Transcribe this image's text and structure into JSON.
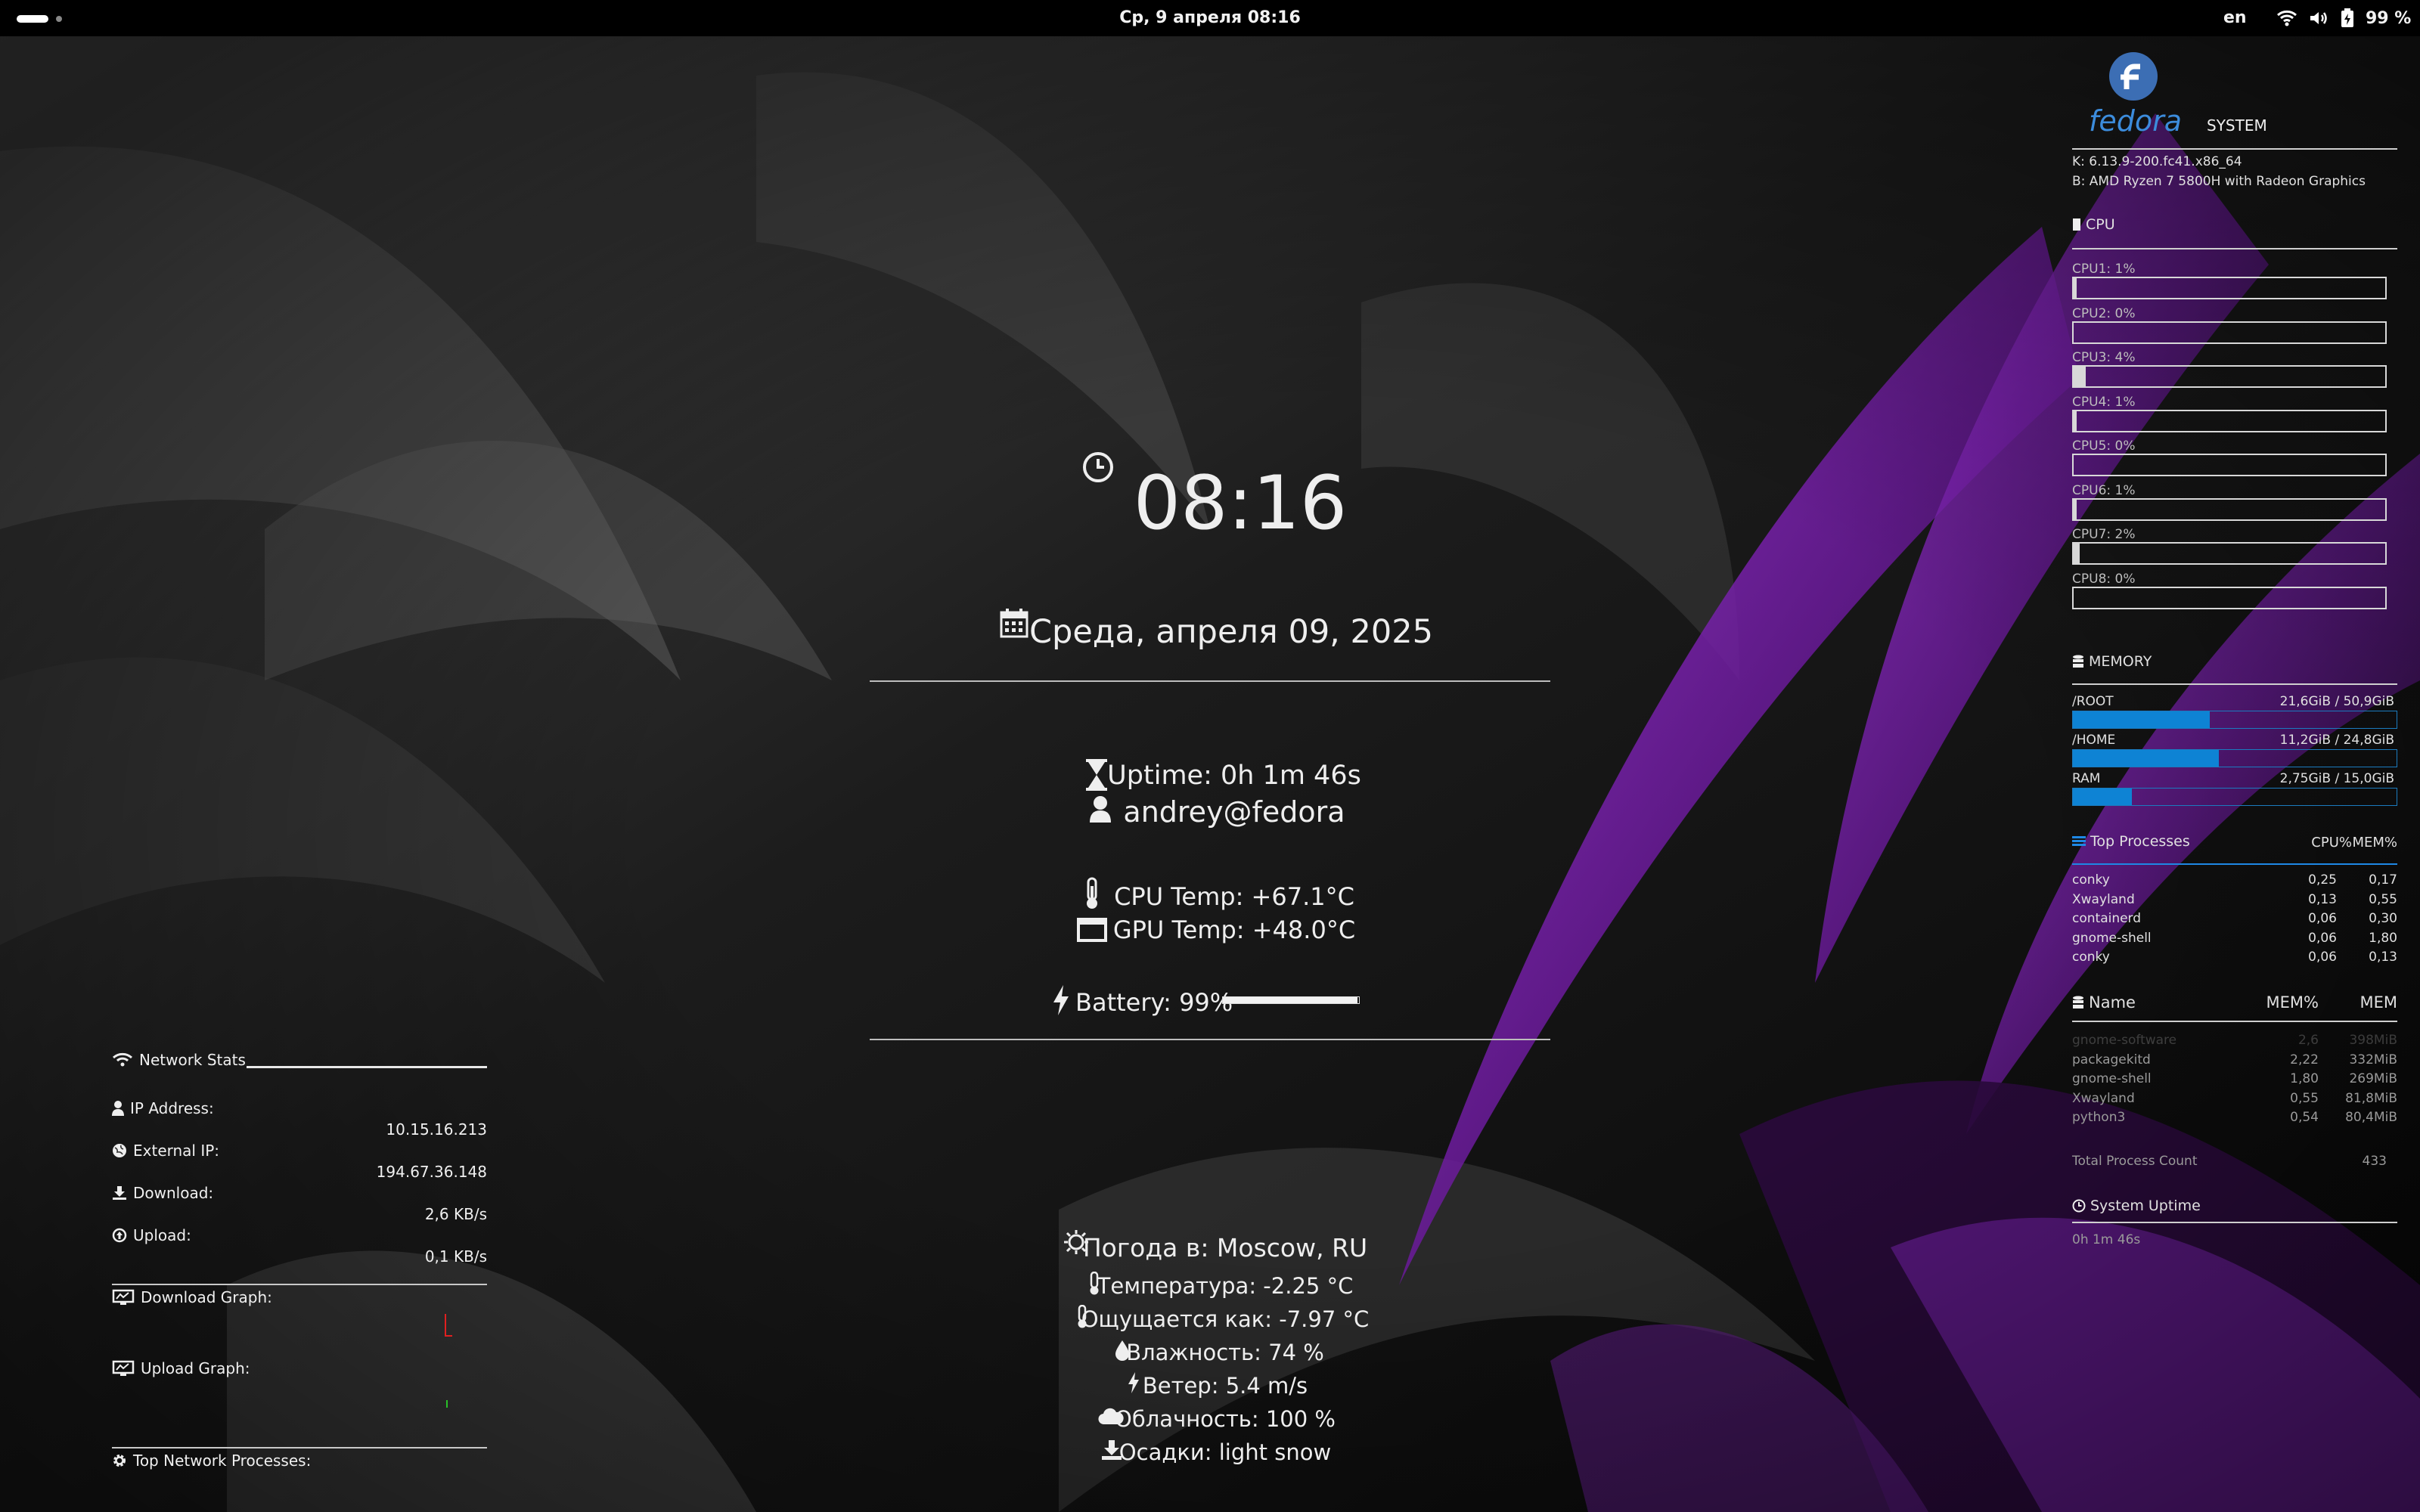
{
  "topbar": {
    "datetime": "Ср, 9 апреля  08:16",
    "lang": "en",
    "battery": "99 %",
    "icons": [
      "activities-indicator",
      "wifi-icon",
      "volume-icon",
      "battery-icon"
    ]
  },
  "center": {
    "time": "08:16",
    "date": "Среда, апреля 09, 2025",
    "uptime": "Uptime: 0h 1m 46s",
    "user": "andrey@fedora",
    "cpu_temp": "CPU Temp: +67.1°C",
    "gpu_temp": "GPU Temp: +48.0°C",
    "battery": "Battery: 99%",
    "battery_level": 0.99,
    "weather": {
      "title": "Погода в: Moscow, RU",
      "temperature": "Температура: -2.25 °C",
      "feels": "Ощущается как: -7.97 °C",
      "humidity": "Влажность: 74 %",
      "wind": "Ветер: 5.4 m/s",
      "clouds": "Облачность: 100 %",
      "precip": "Осадки: light snow"
    }
  },
  "network": {
    "title": "Network Stats",
    "ip_label": "IP Address:",
    "ip": "10.15.16.213",
    "ext_label": "External IP:",
    "ext_ip": "194.67.36.148",
    "down_label": "Download:",
    "down": "2,6 KB/s",
    "up_label": "Upload:",
    "up": "0,1 KB/s",
    "down_graph": "Download Graph:",
    "up_graph": "Upload Graph:",
    "top_proc": "Top Network Processes:"
  },
  "system": {
    "logo": "fedora",
    "section": "SYSTEM",
    "kernel": "K: 6.13.9-200.fc41.x86_64",
    "cpu_model": "B: AMD Ryzen 7 5800H with Radeon Graphics",
    "cpu_title": "CPU",
    "cpus": [
      {
        "label": "CPU1: 1%",
        "value": 1
      },
      {
        "label": "CPU2: 0%",
        "value": 0
      },
      {
        "label": "CPU3: 4%",
        "value": 4
      },
      {
        "label": "CPU4: 1%",
        "value": 1
      },
      {
        "label": "CPU5: 0%",
        "value": 0
      },
      {
        "label": "CPU6: 1%",
        "value": 1
      },
      {
        "label": "CPU7: 2%",
        "value": 2
      },
      {
        "label": "CPU8: 0%",
        "value": 0
      }
    ],
    "memory_title": "MEMORY",
    "mem": [
      {
        "label": "/ROOT",
        "value": "21,6GiB / 50,9GiB",
        "fraction": 0.424
      },
      {
        "label": "/HOME",
        "value": "11,2GiB / 24,8GiB",
        "fraction": 0.452
      },
      {
        "label": "RAM",
        "value": "2,75GiB / 15,0GiB",
        "fraction": 0.183
      }
    ],
    "top_title": "Top Processes",
    "top_cols": [
      "CPU%",
      "MEM%"
    ],
    "top": [
      {
        "name": "conky",
        "cpu": "0,25",
        "mem": "0,17"
      },
      {
        "name": "Xwayland",
        "cpu": "0,13",
        "mem": "0,55"
      },
      {
        "name": "containerd",
        "cpu": "0,06",
        "mem": "0,30"
      },
      {
        "name": "gnome-shell",
        "cpu": "0,06",
        "mem": "1,80"
      },
      {
        "name": "conky",
        "cpu": "0,06",
        "mem": "0,13"
      }
    ],
    "mem_title": "Name",
    "mem_cols": [
      "MEM%",
      "MEM"
    ],
    "memproc": [
      {
        "name": "gnome-software",
        "pct": "2,6",
        "mem": "398MiB"
      },
      {
        "name": "packagekitd",
        "pct": "2,22",
        "mem": "332MiB"
      },
      {
        "name": "gnome-shell",
        "pct": "1,80",
        "mem": "269MiB"
      },
      {
        "name": "Xwayland",
        "pct": "0,55",
        "mem": "81,8MiB"
      },
      {
        "name": "python3",
        "pct": "0,54",
        "mem": "80,4MiB"
      }
    ],
    "total_label": "Total Process Count",
    "total": "433",
    "uptime_title": "System Uptime",
    "uptime": "0h 1m 46s"
  }
}
